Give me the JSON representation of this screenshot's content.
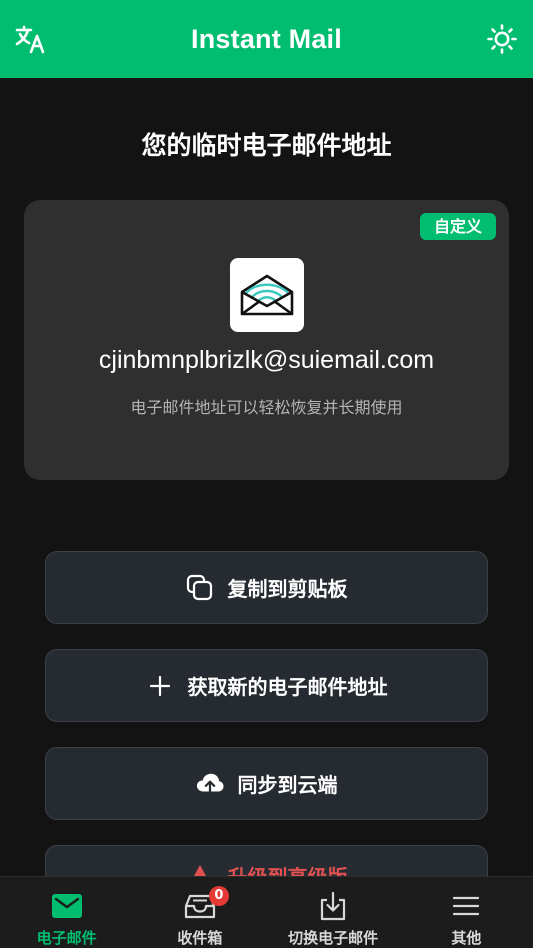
{
  "header": {
    "title": "Instant Mail",
    "lang_icon": "translate-icon",
    "theme_icon": "sun-icon"
  },
  "main": {
    "heading": "您的临时电子邮件地址",
    "card": {
      "badge": "自定义",
      "address": "cjinbmnplbrizlk@suiemail.com",
      "subtitle": "电子邮件地址可以轻松恢复并长期使用"
    },
    "actions": [
      {
        "label": "复制到剪贴板",
        "icon": "copy-icon"
      },
      {
        "label": "获取新的电子邮件地址",
        "icon": "plus-icon"
      },
      {
        "label": "同步到云端",
        "icon": "cloud-upload-icon"
      },
      {
        "label": "升级到高级版",
        "icon": "warning-icon"
      }
    ]
  },
  "bottom_nav": {
    "items": [
      {
        "label": "电子邮件",
        "icon": "mail-icon",
        "active": true
      },
      {
        "label": "收件箱",
        "icon": "inbox-icon",
        "badge": "0"
      },
      {
        "label": "切换电子邮件",
        "icon": "download-icon"
      },
      {
        "label": "其他",
        "icon": "menu-icon"
      }
    ]
  },
  "colors": {
    "accent": "#00bd6f",
    "background": "#131313",
    "card": "#2f2f2f",
    "button": "#262a31",
    "badge_red": "#e53935"
  }
}
